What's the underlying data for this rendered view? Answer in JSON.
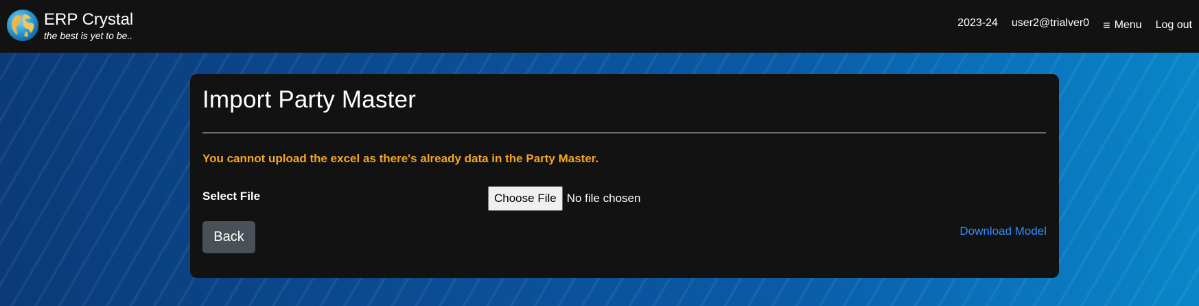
{
  "app": {
    "title": "ERP Crystal",
    "tagline": "the best is yet to be.."
  },
  "nav": {
    "fiscal_year": "2023-24",
    "user": "user2@trialver0",
    "menu_label": "Menu",
    "menu_icon": "hamburger-icon",
    "logout_label": "Log out"
  },
  "page": {
    "title": "Import Party Master",
    "warning": "You cannot upload the excel as there's already data in the Party Master.",
    "select_file_label": "Select File",
    "choose_file_label": "Choose File",
    "file_status": "No file chosen",
    "back_label": "Back",
    "download_label": "Download Model"
  },
  "colors": {
    "navbar_bg": "#121212",
    "card_bg": "#121212",
    "warning": "#f5a623",
    "link": "#2f8cff",
    "back_button": "#495057"
  }
}
